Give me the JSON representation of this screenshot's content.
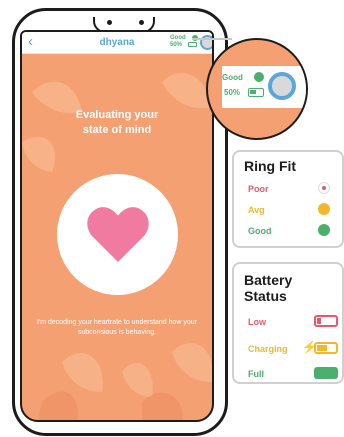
{
  "app": {
    "back_icon": "chevron-left-icon",
    "title": "dhyana",
    "status_label": "Good",
    "battery_percent": "50%"
  },
  "main": {
    "heading_line1": "Evaluating your",
    "heading_line2": "state of mind",
    "footer_text": "I'm decoding your heartrate to understand how your subconsious is behaving.",
    "heart_icon": "heart-icon"
  },
  "zoom": {
    "status_label": "Good",
    "battery_percent": "50%"
  },
  "legend_ring": {
    "title": "Ring Fit",
    "items": [
      {
        "label": "Poor",
        "color": "#e8586b"
      },
      {
        "label": "Avg",
        "color": "#f2b72a"
      },
      {
        "label": "Good",
        "color": "#4caf6e"
      }
    ]
  },
  "legend_battery": {
    "title_line1": "Battery",
    "title_line2": "Status",
    "items": [
      {
        "label": "Low",
        "color": "#e8586b"
      },
      {
        "label": "Charging",
        "color": "#f2b72a"
      },
      {
        "label": "Full",
        "color": "#4caf6e"
      }
    ]
  },
  "colors": {
    "accent": "#5aa7d8",
    "background": "#f4a072"
  }
}
